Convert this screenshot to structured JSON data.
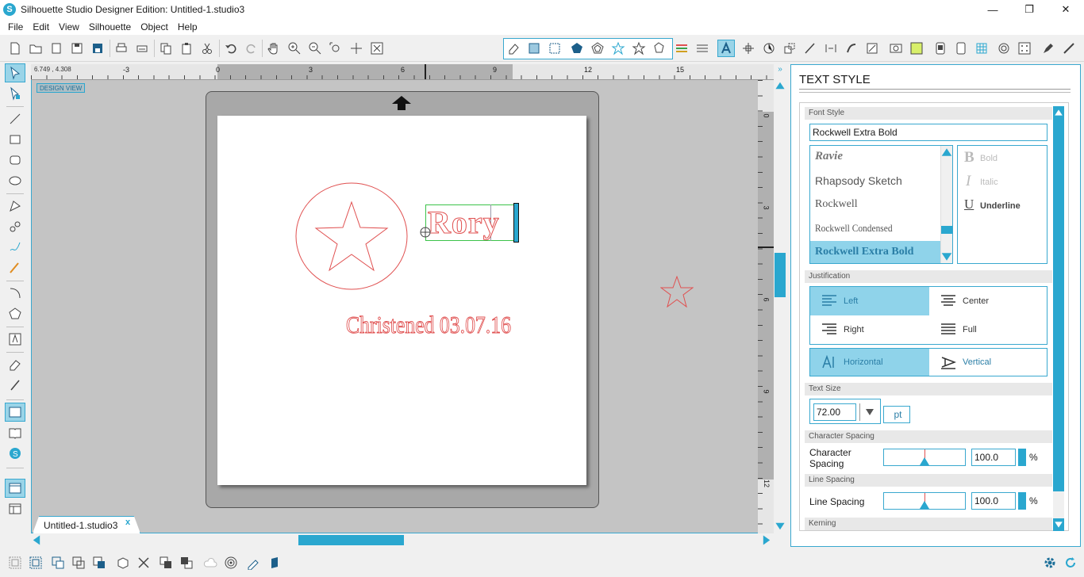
{
  "window": {
    "title": "Silhouette Studio Designer Edition: Untitled-1.studio3",
    "minimize": "—",
    "maximize": "❐",
    "close": "✕"
  },
  "menu": [
    "File",
    "Edit",
    "View",
    "Silhouette",
    "Object",
    "Help"
  ],
  "canvas": {
    "coords": "6.749 , 4.308",
    "design_view_label": "DESIGN VIEW",
    "hruler_labels": [
      "-3",
      "0",
      "3",
      "6",
      "9",
      "12",
      "15"
    ],
    "vruler_labels": [
      "0",
      "3",
      "6",
      "9",
      "12"
    ],
    "text_rory": "Rory",
    "text_christened": "Christened 03.07.16",
    "accent_color": "#2aa7cf",
    "cut_line_color": "#e05050"
  },
  "doc_tab": {
    "name": "Untitled-1.studio3",
    "close": "x"
  },
  "text_style": {
    "panel_title": "TEXT STYLE",
    "font_style_label": "Font Style",
    "font_value": "Rockwell Extra Bold",
    "fonts": [
      "Ravie",
      "Rhapsody Sketch",
      "Rockwell",
      "Rockwell Condensed",
      "Rockwell Extra Bold"
    ],
    "bold": "Bold",
    "italic": "Italic",
    "underline": "Underline",
    "justification_label": "Justification",
    "left": "Left",
    "center": "Center",
    "right": "Right",
    "full": "Full",
    "horizontal": "Horizontal",
    "vertical": "Vertical",
    "text_size_label": "Text Size",
    "text_size_value": "72.00",
    "unit": "pt",
    "char_spacing_header": "Character Spacing",
    "char_spacing_label": "Character Spacing",
    "char_spacing_value": "100.0",
    "line_spacing_header": "Line Spacing",
    "line_spacing_label": "Line Spacing",
    "line_spacing_value": "100.0",
    "percent": "%",
    "kerning_label": "Kerning"
  }
}
